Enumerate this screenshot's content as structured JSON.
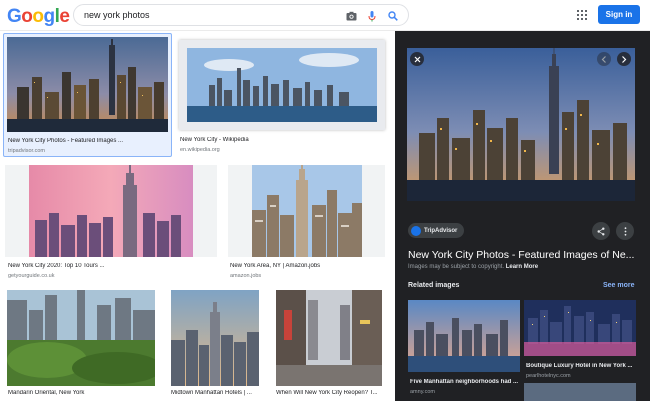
{
  "header": {
    "logo_letters": [
      "G",
      "o",
      "o",
      "g",
      "l",
      "e"
    ],
    "logo_colors": [
      "#4285f4",
      "#ea4335",
      "#fbbc05",
      "#4285f4",
      "#34a853",
      "#ea4335"
    ],
    "search_value": "new york photos",
    "signin_label": "Sign in",
    "accent": "#1a73e8"
  },
  "results": [
    {
      "caption": "New York City Photos - Featured Images ...",
      "source": "tripadvisor.com",
      "selected": true
    },
    {
      "caption": "New York City - Wikipedia",
      "source": "en.wikipedia.org"
    },
    {
      "caption": "New York City 2020: Top 10 Tours ...",
      "source": "getyourguide.co.uk"
    },
    {
      "caption": "New York Area, NY | Amazon.jobs",
      "source": "amazon.jobs"
    },
    {
      "caption": "Mandarin Oriental, New York",
      "source": ""
    },
    {
      "caption": "Midtown Manhattan Hotels | ...",
      "source": ""
    },
    {
      "caption": "When Will New York City Reopen? T...",
      "source": ""
    }
  ],
  "panel": {
    "source_chip": "TripAdvisor",
    "title": "New York City Photos - Featured Images of Ne...",
    "copyright_note": "Images may be subject to copyright.",
    "learn_more": "Learn More",
    "related_heading": "Related images",
    "see_more": "See more",
    "related": [
      {
        "caption": "Five Manhattan neighborhoods had ...",
        "source": "amny.com"
      },
      {
        "caption": "Boutique Luxury Hotel in New York ...",
        "source": "pearlhotelnyc.com"
      }
    ]
  },
  "icons": [
    "camera-icon",
    "microphone-icon",
    "search-icon",
    "apps-grid-icon",
    "close-icon",
    "chevron-left-icon",
    "chevron-right-icon",
    "share-icon",
    "more-vert-icon"
  ]
}
